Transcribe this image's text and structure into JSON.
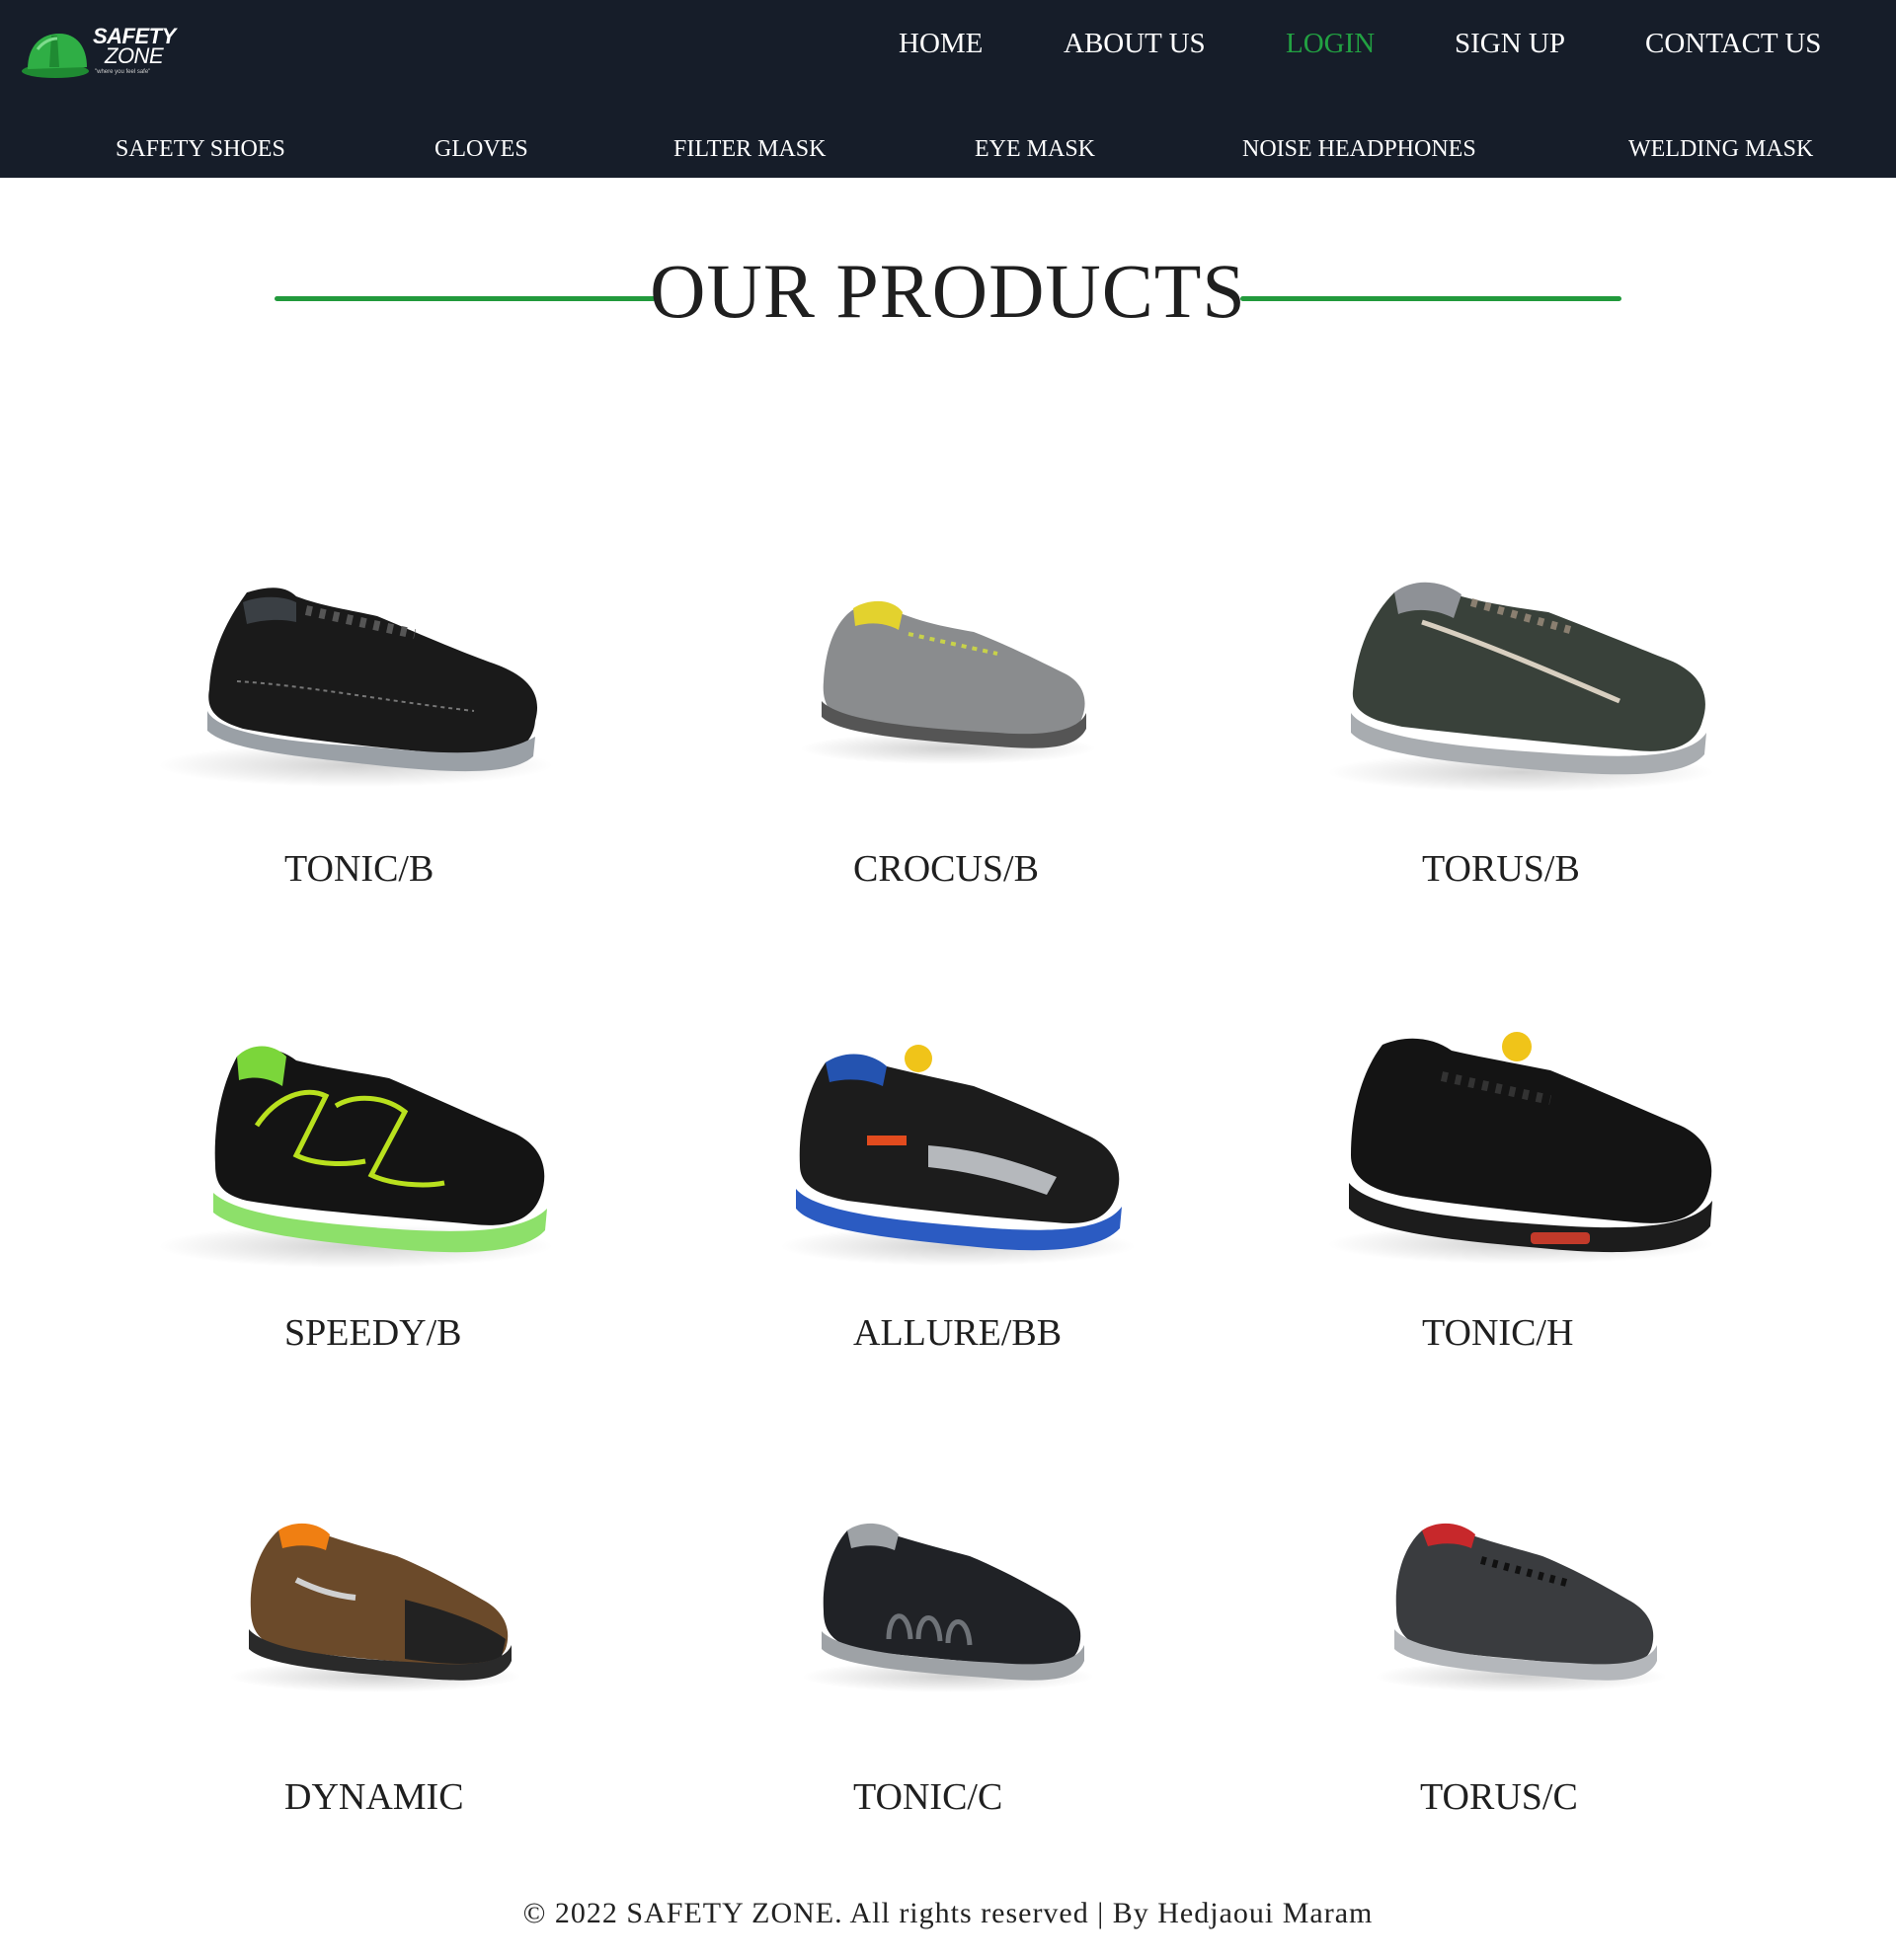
{
  "brand": {
    "name_line1": "SAFETY",
    "name_line2": "ZONE",
    "tagline": "\"where you feel safe\""
  },
  "nav": {
    "home": "HOME",
    "about": "ABOUT US",
    "login": "LOGIN",
    "signup": "SIGN UP",
    "contact": "CONTACT US"
  },
  "categories": {
    "safety_shoes": "SAFETY SHOES",
    "gloves": "GLOVES",
    "filter_mask": "FILTER MASK",
    "eye_mask": "EYE MASK",
    "noise_headphones": "NOISE HEADPHONES",
    "welding_mask": "WELDING MASK"
  },
  "main": {
    "title": "OUR PRODUCTS",
    "products": [
      {
        "name": "TONIC/B"
      },
      {
        "name": "CROCUS/B"
      },
      {
        "name": "TORUS/B"
      },
      {
        "name": "SPEEDY/B"
      },
      {
        "name": "ALLURE/BB"
      },
      {
        "name": "TONIC/H"
      },
      {
        "name": "DYNAMIC"
      },
      {
        "name": "TONIC/C"
      },
      {
        "name": "TORUS/C"
      }
    ]
  },
  "footer": {
    "text": "© 2022 SAFETY ZONE. All rights reserved | By Hedjaoui Maram"
  },
  "colors": {
    "header_bg": "#161d29",
    "accent_green": "#22a142"
  }
}
